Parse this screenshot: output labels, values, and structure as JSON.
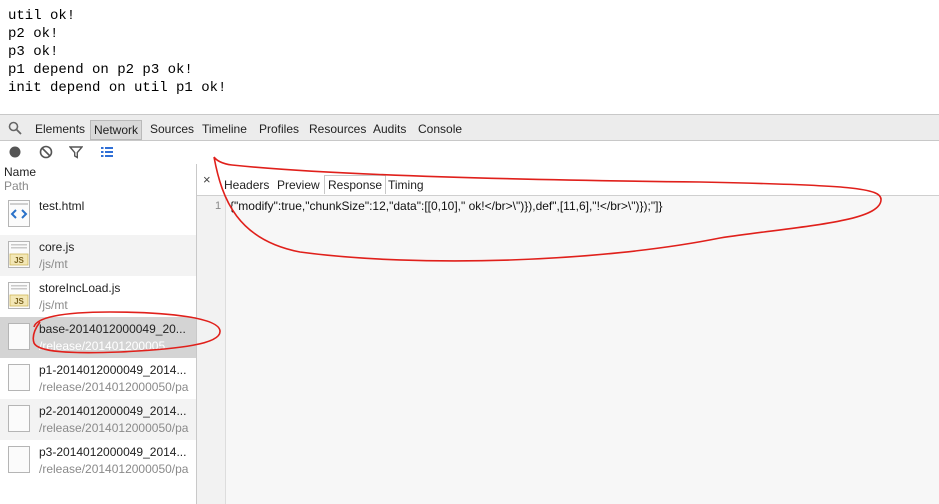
{
  "page_output": [
    "util ok!",
    "p2 ok!",
    "p3 ok!",
    "p1 depend on p2 p3 ok!",
    "init depend on util p1 ok!"
  ],
  "devtools": {
    "tabs": [
      "Elements",
      "Network",
      "Sources",
      "Timeline",
      "Profiles",
      "Resources",
      "Audits",
      "Console"
    ],
    "selected_tab": "Network",
    "toolbar_icons": [
      "record-icon",
      "clear-icon",
      "filter-icon",
      "large-rows-icon"
    ]
  },
  "request_list": {
    "header_name": "Name",
    "header_path": "Path",
    "rows": [
      {
        "name": "test.html",
        "path": "",
        "icon": "html-file-icon"
      },
      {
        "name": "core.js",
        "path": "/js/mt",
        "icon": "js-file-icon"
      },
      {
        "name": "storeIncLoad.js",
        "path": "/js/mt",
        "icon": "js-file-icon"
      },
      {
        "name": "base-2014012000049_20...",
        "path": "/release/201401200005",
        "icon": "blank-file-icon"
      },
      {
        "name": "p1-2014012000049_2014...",
        "path": "/release/2014012000050/pa",
        "icon": "blank-file-icon"
      },
      {
        "name": "p2-2014012000049_2014...",
        "path": "/release/2014012000050/pa",
        "icon": "blank-file-icon"
      },
      {
        "name": "p3-2014012000049_2014...",
        "path": "/release/2014012000050/pa",
        "icon": "blank-file-icon"
      }
    ]
  },
  "detail": {
    "close_glyph": "×",
    "tabs": [
      "Headers",
      "Preview",
      "Response",
      "Timing"
    ],
    "selected_tab": "Response",
    "line_number": "1",
    "response_text": "{\"modify\":true,\"chunkSize\":12,\"data\":[[0,10],\" ok!</br>\\\")}),def\",[11,6],\"!</br>\\\")});\"]}"
  },
  "colors": {
    "annotation": "#e0201b",
    "tabbar_bg": "#ececec",
    "selected_row_bg": "#d4d4d4"
  }
}
